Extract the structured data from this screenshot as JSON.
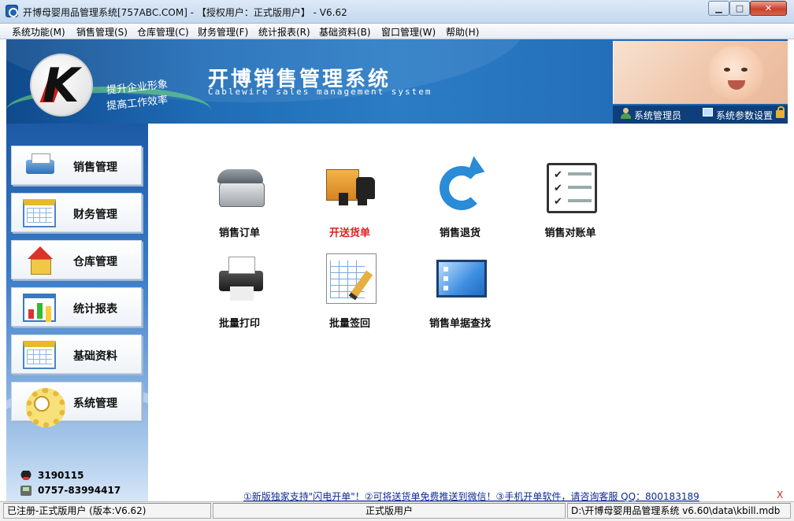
{
  "window": {
    "title": "开博母婴用品管理系统[757ABC.COM] - 【授权用户：正式版用户】 - V6.62",
    "minimize": "▁",
    "maximize": "□",
    "close": "✕"
  },
  "menu": [
    {
      "label": "系统功能(M)"
    },
    {
      "label": "销售管理(S)"
    },
    {
      "label": "仓库管理(C)"
    },
    {
      "label": "财务管理(F)"
    },
    {
      "label": "统计报表(R)"
    },
    {
      "label": "基础资料(B)"
    },
    {
      "label": "窗口管理(W)"
    },
    {
      "label": "帮助(H)"
    }
  ],
  "banner": {
    "logo_letter": "K",
    "slogan_line1": "提升企业形象",
    "slogan_line2": "提高工作效率",
    "title": "开博销售管理系统",
    "subtitle": "Cablewire sales management system",
    "user": "系统管理员",
    "settings": "系统参数设置"
  },
  "sidebar": {
    "items": [
      {
        "label": "销售管理",
        "icon": "printer-icon"
      },
      {
        "label": "财务管理",
        "icon": "calendar-icon"
      },
      {
        "label": "仓库管理",
        "icon": "house-icon"
      },
      {
        "label": "统计报表",
        "icon": "chart-icon"
      },
      {
        "label": "基础资料",
        "icon": "calendar-icon"
      },
      {
        "label": "系统管理",
        "icon": "gear-icon"
      }
    ],
    "qq": "3190115",
    "phone": "0757-83994417"
  },
  "functions": [
    {
      "label": "销售订单",
      "icon": "telephone-icon",
      "color": "#111111"
    },
    {
      "label": "开送货单",
      "icon": "truck-icon",
      "color": "#e02020"
    },
    {
      "label": "销售退货",
      "icon": "return-arrow-icon",
      "color": "#111111"
    },
    {
      "label": "销售对账单",
      "icon": "checklist-icon",
      "color": "#111111"
    },
    {
      "label": "批量打印",
      "icon": "printer-icon",
      "color": "#111111"
    },
    {
      "label": "批量签回",
      "icon": "sign-sheet-icon",
      "color": "#111111"
    },
    {
      "label": "销售单据查找",
      "icon": "window-list-icon",
      "color": "#111111"
    }
  ],
  "notice": {
    "text": "①新版独家支持\"闪电开单\"！②可将送货单免费推送到微信！③手机开单软件，请咨询客服 QQ：800183189",
    "close": "X"
  },
  "status": {
    "registered": "已注册-正式版用户 (版本:V6.62)",
    "edition": "正式版用户",
    "db_path": "D:\\开博母婴用品管理系统 v6.60\\data\\kbill.mdb"
  },
  "colors": {
    "banner_blue": "#1f6cb7",
    "highlight_red": "#e02020",
    "link_blue": "#0b2b94"
  }
}
